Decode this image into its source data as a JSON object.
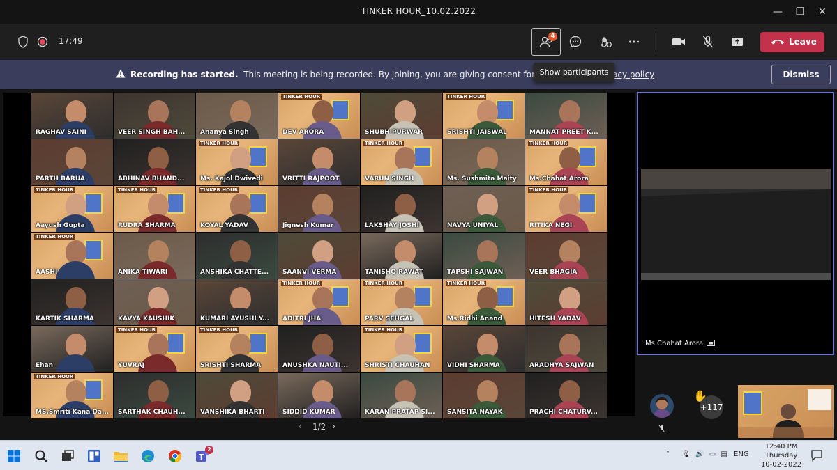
{
  "window": {
    "title": "TINKER HOUR_10.02.2022"
  },
  "toolbar": {
    "timer": "17:49",
    "participants_badge": "4",
    "leave_label": "Leave"
  },
  "banner": {
    "heading": "Recording has started.",
    "message": "This meeting is being recorded. By joining, you are giving consent for this meeting",
    "policy_link": "acy policy",
    "dismiss_label": "Dismiss"
  },
  "tooltip": "Show participants",
  "tile_poster_title": "TINKER HOUR",
  "participants": [
    "RAGHAV SAINI",
    "VEER SINGH BAH...",
    "Ananya Singh",
    "DEV ARORA",
    "SHUBH PURWAR",
    "SRISHTI JAISWAL",
    "MANNAT PREET K...",
    "PARTH BARUA",
    "ABHINAV BHAND...",
    "Ms. Kajol Dwivedi",
    "VRITTI RAJPOOT",
    "VARUN SINGH",
    "Ms. Sushmita Maity",
    "Ms.Chahat Arora",
    "Aayush Gupta",
    "RUDRA SHARMA",
    "KOYAL YADAV",
    "Jignesh Kumar",
    "LAKSHAY JOSHI",
    "NAVYA UNIYAL",
    "RITIKA NEGI",
    "AASHI",
    "ANIKA TIWARI",
    "ANSHIKA CHATTE...",
    "SAANVI VERMA",
    "TANISHQ RAWAT",
    "TAPSHI SAJWAN",
    "VEER BHAGIA",
    "KARTIK SHARMA",
    "KAVYA KAUSHIK",
    "KUMARI AYUSHI Y...",
    "ADITRI JHA",
    "PARV SEHGAL",
    "Ms.Ridhi Anand",
    "HITESH YADAV",
    "Ehan",
    "YUVRAJ",
    "SRISHTI SHARMA",
    "ANUSHKA NAUTI...",
    "SHRISTI CHAUHAN",
    "VIDHI SHARMA",
    "ARADHYA SAJWAN",
    "MS.Smriti Kana Da...",
    "SARTHAK CHAUH...",
    "VANSHIKA BHARTI",
    "SIDDID KUMAR",
    "KARAN PRATAP SI...",
    "SANSITA NAYAK",
    "PRACHI CHATURV..."
  ],
  "pager": {
    "label": "1/2",
    "prev": "‹",
    "next": "›"
  },
  "spotlight": {
    "name": "Ms.Chahat Arora"
  },
  "overflow": {
    "count": "+117"
  },
  "taskbar": {
    "teams_badge": "2",
    "lang": "ENG",
    "time": "12:40 PM",
    "day": "Thursday",
    "date": "10-02-2022"
  },
  "colors": {
    "leave": "#c4314b",
    "banner": "#3a3d5c",
    "accent": "#6e74c6"
  }
}
